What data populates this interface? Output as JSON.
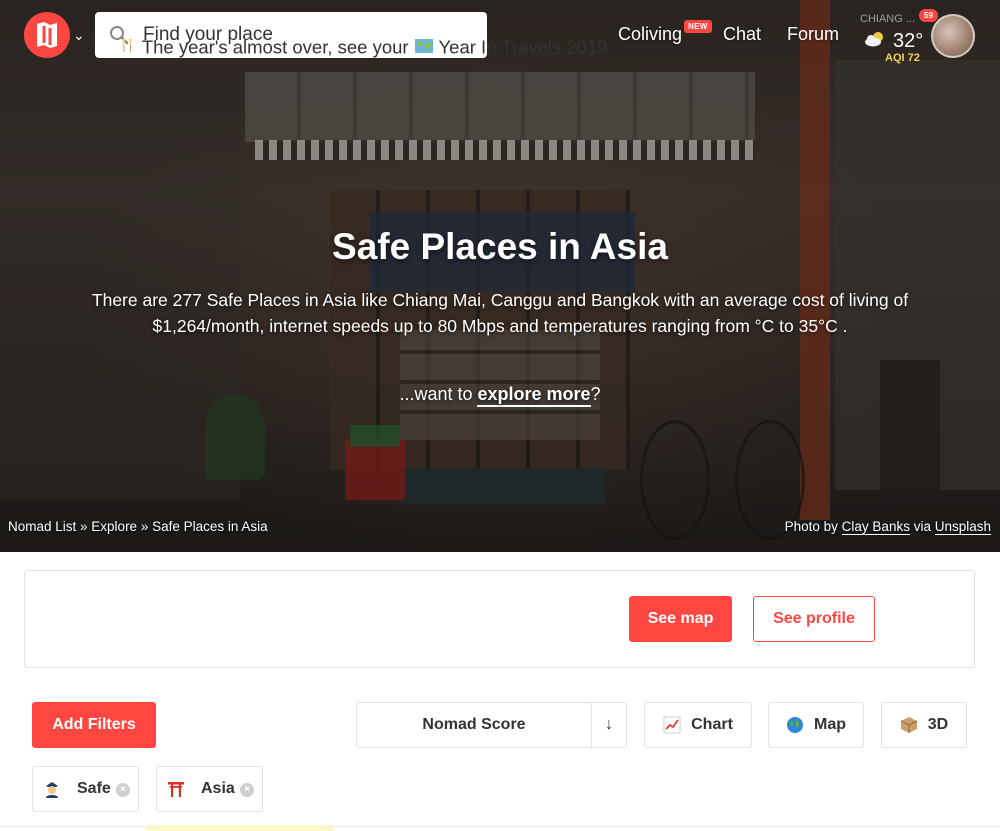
{
  "header": {
    "search_placeholder": "Find your place",
    "nav": {
      "coliving": "Coliving",
      "coliving_badge": "NEW",
      "chat": "Chat",
      "forum": "Forum"
    },
    "weather": {
      "city": "CHIANG ...",
      "temp": "32°",
      "aqi": "AQI 72",
      "icon": "partly-cloudy-icon"
    },
    "notifications": "59"
  },
  "hero": {
    "title": "Safe Places in Asia",
    "description": "There are 277 Safe Places in Asia like Chiang Mai, Canggu and Bangkok with an average cost of living of $1,264/month, internet speeds up to 80 Mbps and temperatures ranging from °C to 35°C .",
    "explore_prefix": "...want to ",
    "explore_link": "explore more",
    "explore_suffix": "?",
    "breadcrumb": [
      "Nomad List",
      "Explore",
      "Safe Places in Asia"
    ],
    "breadcrumb_sep": " » ",
    "credit_prefix": "Photo by ",
    "credit_author": "Clay Banks",
    "credit_via": " via ",
    "credit_source": "Unsplash"
  },
  "banner": {
    "text_before": "The year's almost over, see your",
    "text_after": "Year In Travels 2019",
    "see_map": "See map",
    "see_profile": "See profile"
  },
  "controls": {
    "add_filters": "Add Filters",
    "sort_label": "Nomad Score",
    "sort_dir": "↓",
    "chart": "Chart",
    "map": "Map",
    "threeD": "3D"
  },
  "filters": [
    {
      "label": "Safe",
      "icon": "police-officer-icon"
    },
    {
      "label": "Asia",
      "icon": "torii-gate-icon"
    }
  ],
  "colors": {
    "brand_red": "#ff4742",
    "aqi_yellow": "#f7d24b"
  }
}
